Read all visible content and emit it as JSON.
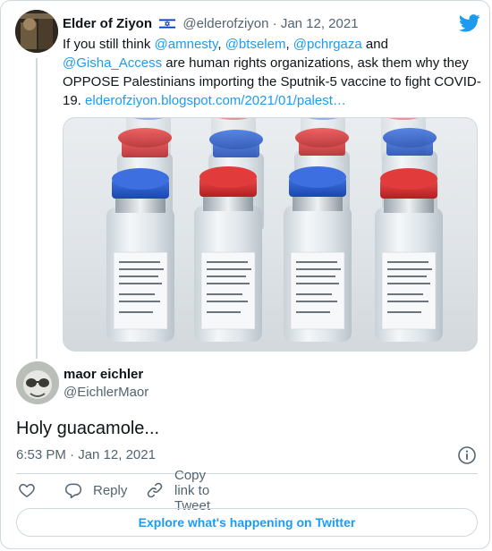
{
  "colors": {
    "accent": "#1d9bf0",
    "text": "#0f1419",
    "secondary": "#536471",
    "border": "#cfd9de"
  },
  "parent_tweet": {
    "name": "Elder of Ziyon",
    "flag_icon": "israel-flag-icon",
    "handle": "@elderofziyon",
    "separator": "·",
    "date": "Jan 12, 2021",
    "text_1": "If you still think ",
    "mention_1": "@amnesty",
    "text_2": ", ",
    "mention_2": "@btselem",
    "text_3": ", ",
    "mention_3": "@pchrgaza",
    "text_4": " and ",
    "mention_4": "@Gisha_Access",
    "text_5": " are human rights organizations, ask them why they OPPOSE Palestinians importing the Sputnik-5 vaccine to fight COVID-19. ",
    "link": "elderofziyon.blogspot.com/2021/01/palest…",
    "media_icon": "vaccine-vials-photo"
  },
  "reply_tweet": {
    "name": "maor eichler",
    "handle": "@EichlerMaor",
    "text": "Holy guacamole...",
    "time": "6:53 PM · Jan 12, 2021"
  },
  "actions": {
    "like_icon": "heart-icon",
    "reply_label": "Reply",
    "copy_label": "Copy link to Tweet"
  },
  "explore_label": "Explore what's happening on Twitter"
}
